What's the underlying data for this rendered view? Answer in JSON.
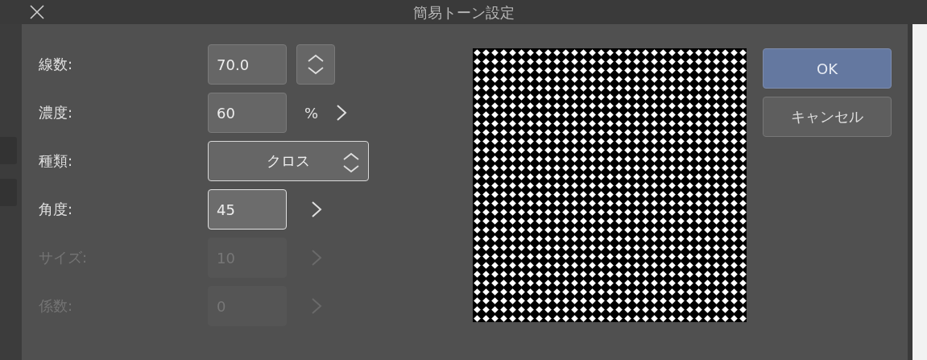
{
  "window": {
    "title": "簡易トーン設定"
  },
  "settings": [
    {
      "label": "線数:",
      "kind": "stepper",
      "value": "70.0",
      "disabled": false,
      "focused": false
    },
    {
      "label": "濃度:",
      "kind": "percent",
      "value": "60",
      "unit": "%",
      "disabled": false,
      "focused": false
    },
    {
      "label": "種類:",
      "kind": "select",
      "value": "クロス",
      "disabled": false
    },
    {
      "label": "角度:",
      "kind": "chevron",
      "value": "45",
      "disabled": false,
      "focused": true
    },
    {
      "label": "サイズ:",
      "kind": "chevron",
      "value": "10",
      "disabled": true,
      "focused": false
    },
    {
      "label": "係数:",
      "kind": "chevron",
      "value": "0",
      "disabled": true,
      "focused": false
    }
  ],
  "buttons": [
    {
      "label": "OK",
      "primary": true
    },
    {
      "label": "キャンセル",
      "primary": false
    }
  ]
}
